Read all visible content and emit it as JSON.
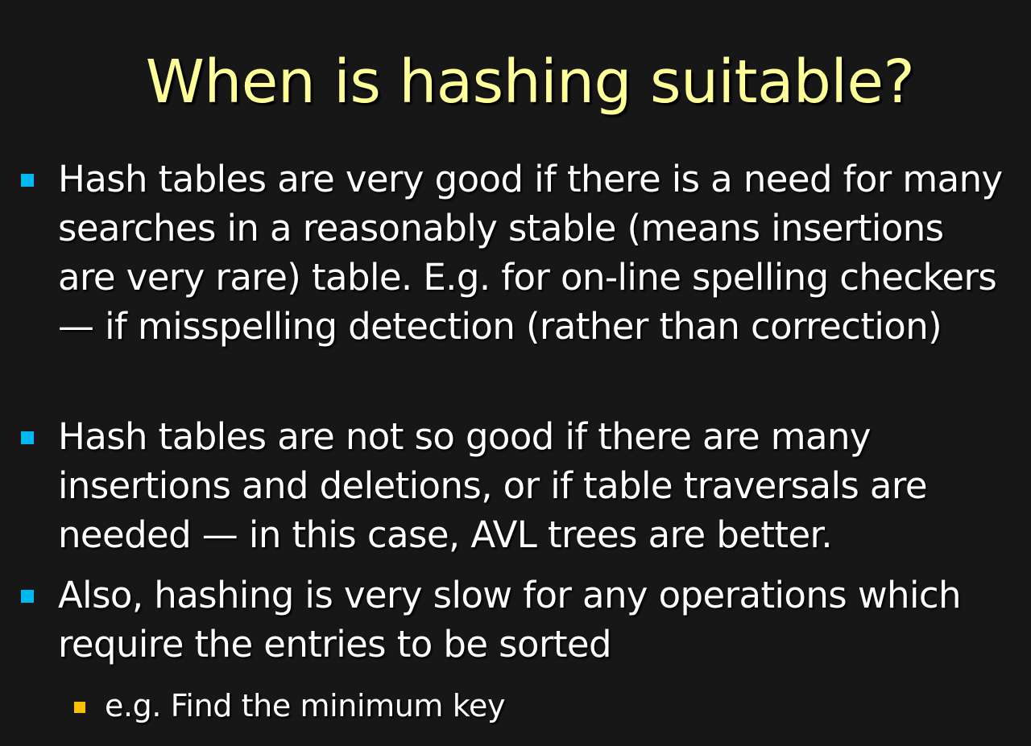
{
  "slide": {
    "title": "When is hashing suitable?",
    "bullets": [
      {
        "text": "Hash tables are very good if there is a need for many searches in a reasonably stable (means insertions are very rare) table. E.g. for on-line spelling checkers — if misspelling detection (rather than correction)"
      },
      {
        "text": "Hash tables are not so good if there are many insertions and deletions, or if table traversals are needed — in this case, AVL trees are better."
      },
      {
        "text": "Also, hashing is very slow for any operations which require the entries to be sorted",
        "sub_bullets": [
          {
            "text": "e.g. Find the minimum key"
          }
        ]
      }
    ]
  },
  "colors": {
    "background": "#171717",
    "title": "#ffff99",
    "body_text": "#ffffff",
    "bullet_marker": "#00b8f0",
    "sub_bullet_marker": "#f5c000"
  }
}
